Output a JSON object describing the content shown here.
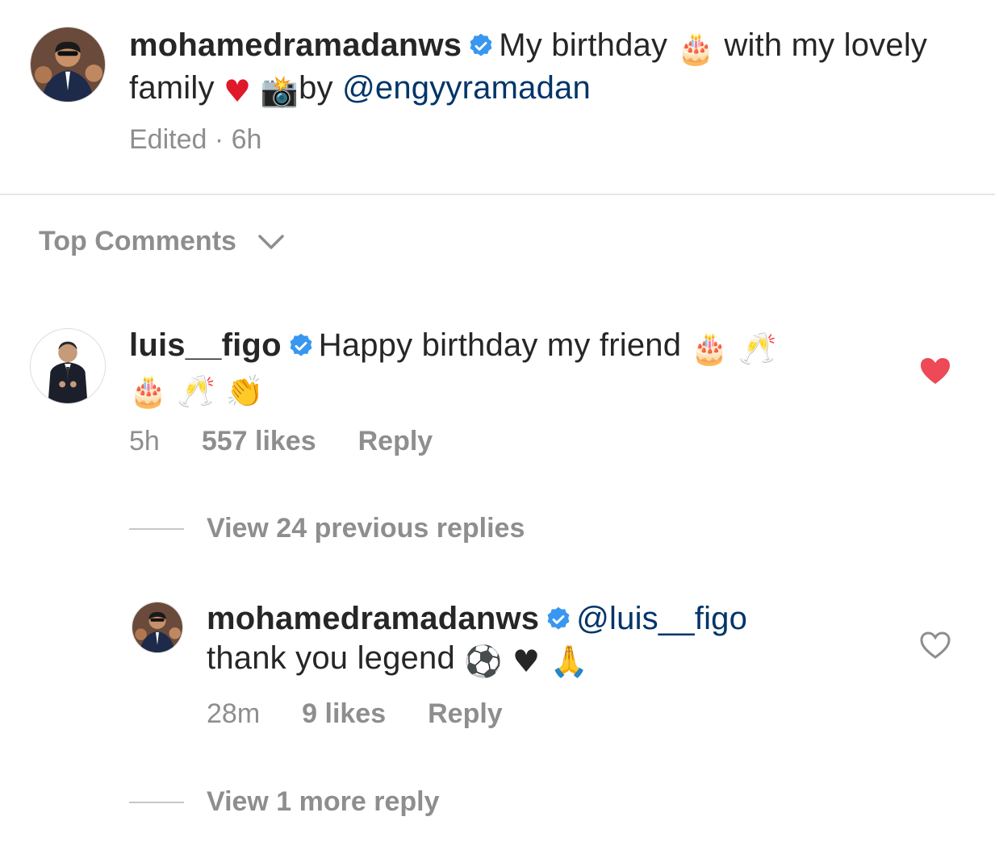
{
  "post": {
    "username": "mohamedramadanws",
    "caption_text_1": "My birthday",
    "caption_emoji_cake": "🎂",
    "caption_text_2": "with my lovely family",
    "caption_emoji_heart": "♥",
    "caption_emoji_camera": "📸",
    "caption_text_3": "by",
    "caption_mention": "@engyyramadan",
    "meta": "Edited · 6h"
  },
  "comments_header": {
    "label": "Top Comments"
  },
  "comment": {
    "username": "luis__figo",
    "text": "Happy birthday my friend",
    "emoji_line_1": "🎂 🥂",
    "emoji_line_2": "🎂 🥂 👏",
    "time": "5h",
    "likes": "557 likes",
    "reply": "Reply",
    "liked": true
  },
  "view_previous": {
    "label": "View 24 previous replies"
  },
  "reply": {
    "username": "mohamedramadanws",
    "mention": "@luis__figo",
    "text": "thank you legend",
    "emojis": "⚽ ♥ 🙏",
    "time": "28m",
    "likes": "9 likes",
    "reply": "Reply",
    "liked": false
  },
  "view_more": {
    "label": "View 1 more reply"
  },
  "colors": {
    "verified": "#3897f0",
    "like_red": "#ed4956",
    "mention": "#003569",
    "muted": "#8e8e8e"
  }
}
